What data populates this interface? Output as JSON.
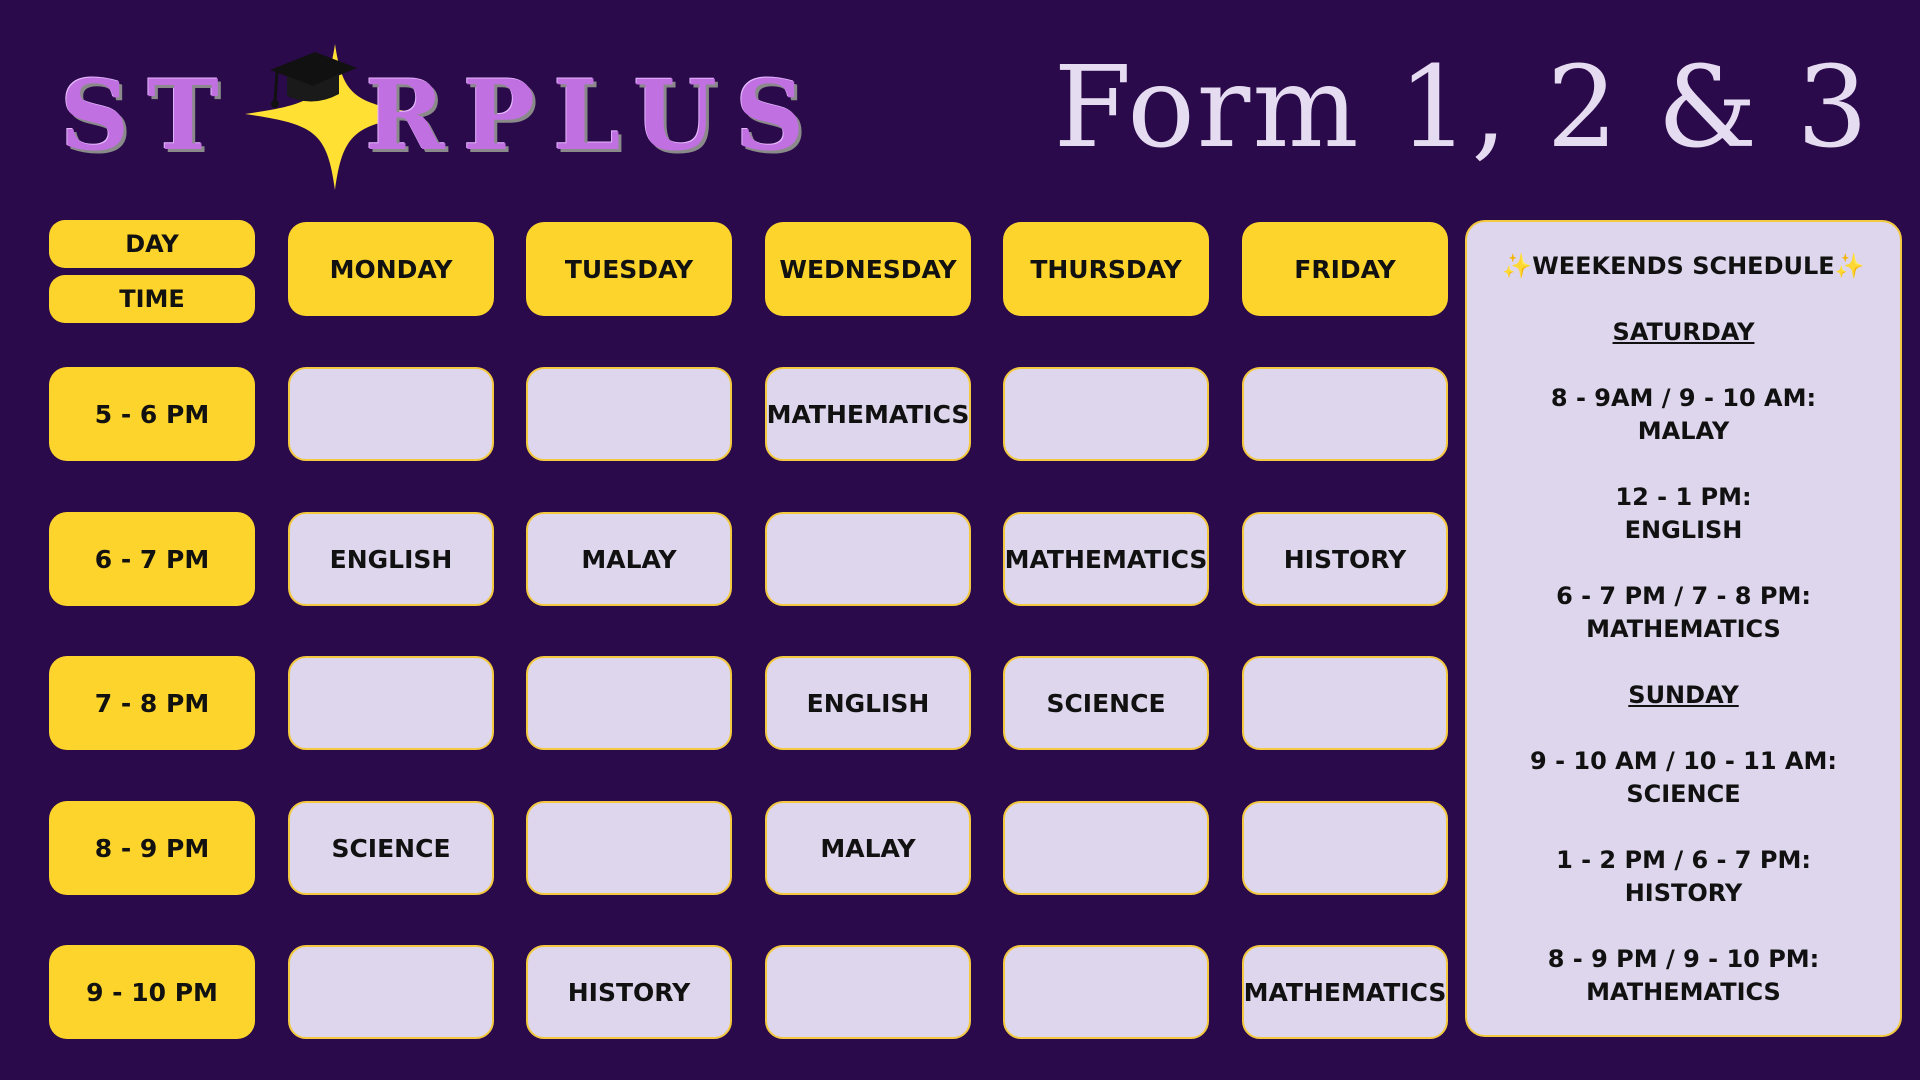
{
  "logo": {
    "text_left": "ST",
    "text_right": "RPLUS",
    "alt": "STARPLUS"
  },
  "title": "Form 1, 2 & 3",
  "header": {
    "day_label": "DAY",
    "time_label": "TIME"
  },
  "days": [
    "MONDAY",
    "TUESDAY",
    "WEDNESDAY",
    "THURSDAY",
    "FRIDAY"
  ],
  "times": [
    "5 - 6 PM",
    "6 - 7 PM",
    "7 - 8 PM",
    "8 - 9 PM",
    "9 - 10 PM"
  ],
  "schedule": [
    [
      "",
      "",
      "MATHEMATICS",
      "",
      ""
    ],
    [
      "ENGLISH",
      "MALAY",
      "",
      "MATHEMATICS",
      "HISTORY"
    ],
    [
      "",
      "",
      "ENGLISH",
      "SCIENCE",
      ""
    ],
    [
      "SCIENCE",
      "",
      "MALAY",
      "",
      ""
    ],
    [
      "",
      "HISTORY",
      "",
      "",
      "MATHEMATICS"
    ]
  ],
  "weekend": {
    "sparkle": "✨",
    "title": "WEEKENDS SCHEDULE",
    "saturday": {
      "label": "SATURDAY",
      "slots": [
        {
          "time": "8 - 9AM / 9 - 10 AM:",
          "subject": "MALAY"
        },
        {
          "time": "12 - 1 PM:",
          "subject": "ENGLISH"
        },
        {
          "time": "6 - 7 PM / 7 - 8 PM:",
          "subject": "MATHEMATICS"
        }
      ]
    },
    "sunday": {
      "label": "SUNDAY",
      "slots": [
        {
          "time": "9 - 10 AM / 10 - 11 AM:",
          "subject": "SCIENCE"
        },
        {
          "time": "1 - 2 PM / 6 - 7 PM:",
          "subject": "HISTORY"
        },
        {
          "time": "8 - 9 PM / 9 - 10 PM:",
          "subject": "MATHEMATICS"
        }
      ]
    }
  },
  "colors": {
    "background": "#2a0a4a",
    "accent_yellow": "#fdd42b",
    "cell_lavender": "#ded6ec",
    "logo_purple": "#c070e0",
    "title_color": "#e6dcf2"
  }
}
